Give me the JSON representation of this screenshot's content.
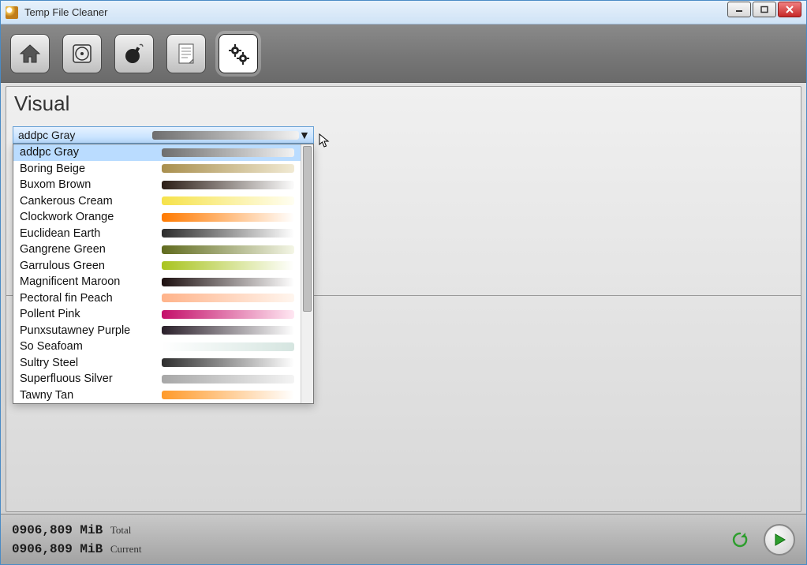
{
  "window": {
    "title": "Temp File Cleaner"
  },
  "toolbar": {
    "home": "home-icon",
    "disk": "disk-icon",
    "bomb": "bomb-icon",
    "report": "report-icon",
    "settings": "gears-icon"
  },
  "section": {
    "title": "Visual"
  },
  "combo": {
    "selected_label": "addpc Gray",
    "selected_swatch": [
      "#6e6e6e",
      "#f2f2f2"
    ],
    "options": [
      {
        "label": "addpc Gray",
        "c1": "#6e6e6e",
        "c2": "#f2f2f2",
        "selected": true
      },
      {
        "label": "Boring Beige",
        "c1": "#a98f4e",
        "c2": "#f1ead4"
      },
      {
        "label": "Buxom Brown",
        "c1": "#2c1e16",
        "c2": "#fcfcfc"
      },
      {
        "label": "Cankerous Cream",
        "c1": "#f6e24a",
        "c2": "#fffef2"
      },
      {
        "label": "Clockwork Orange",
        "c1": "#ff7a00",
        "c2": "#ffffff"
      },
      {
        "label": "Euclidean Earth",
        "c1": "#2c2c2c",
        "c2": "#ffffff"
      },
      {
        "label": "Gangrene Green",
        "c1": "#606b1e",
        "c2": "#f4f6e6"
      },
      {
        "label": "Garrulous Green",
        "c1": "#a9c41f",
        "c2": "#ffffff"
      },
      {
        "label": "Magnificent Maroon",
        "c1": "#1d1010",
        "c2": "#ffffff"
      },
      {
        "label": "Pectoral fin Peach",
        "c1": "#ffb38a",
        "c2": "#fff6ef"
      },
      {
        "label": "Pollent Pink",
        "c1": "#c4106a",
        "c2": "#ffe7f2"
      },
      {
        "label": "Punxsutawney Purple",
        "c1": "#2a1f2a",
        "c2": "#ffffff"
      },
      {
        "label": "So Seafoam",
        "c1": "#ffffff",
        "c2": "#d5e5e0"
      },
      {
        "label": "Sultry Steel",
        "c1": "#2e2e2e",
        "c2": "#ffffff"
      },
      {
        "label": "Superfluous Silver",
        "c1": "#a7a7a7",
        "c2": "#f4f4f4"
      },
      {
        "label": "Tawny Tan",
        "c1": "#ff9a2a",
        "c2": "#ffffff"
      }
    ]
  },
  "footer": {
    "total_value": "0906,809 MiB",
    "total_label": "Total",
    "current_value": "0906,809 MiB",
    "current_label": "Current"
  }
}
